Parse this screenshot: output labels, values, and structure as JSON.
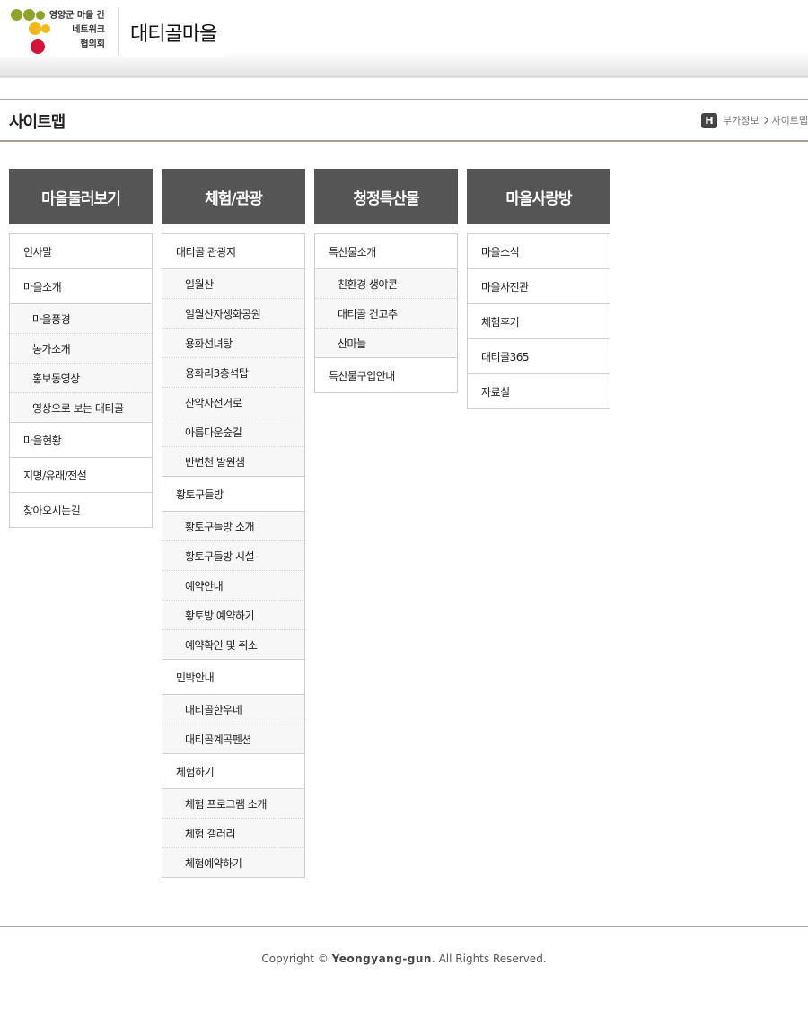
{
  "header": {
    "logo_line1": "영양군 마을 간",
    "logo_line2": "네트워크",
    "logo_line3": "협의회",
    "village_name": "대티골마을",
    "colors": {
      "olive": "#8fa22a",
      "yellow": "#f3b81b",
      "red": "#d2143a"
    }
  },
  "titlebar": {
    "title": "사이트맵",
    "home_icon_label": "H",
    "crumb1": "부가정보",
    "crumb2": "사이트맵"
  },
  "columns": [
    {
      "title": "마을둘러보기",
      "items": [
        "인사말",
        "마을소개",
        "마을현황",
        "지명/유래/전설",
        "찾아오시는길"
      ],
      "subs_of_item1": [
        "마을풍경",
        "농가소개",
        "홍보동영상",
        "영상으로 보는 대티골"
      ]
    },
    {
      "title": "체험/관광",
      "groups": [
        {
          "label": "대티골 관광지",
          "subs": [
            "일월산",
            "일월산자생화공원",
            "용화선녀탕",
            "용화리3층석탑",
            "산악자전거로",
            "아름다운숲길",
            "반변천 발원샘"
          ]
        },
        {
          "label": "황토구들방",
          "subs": [
            "황토구들방 소개",
            "황토구들방 시설",
            "예약안내",
            "황토방 예약하기",
            "예약확인 및 취소"
          ]
        },
        {
          "label": "민박안내",
          "subs": [
            "대티골한우네",
            "대티골계곡펜션"
          ]
        },
        {
          "label": "체험하기",
          "subs": [
            "체험 프로그램 소개",
            "체험 갤러리",
            "체험예약하기"
          ]
        }
      ]
    },
    {
      "title": "청정특산물",
      "groups": [
        {
          "label": "특산물소개",
          "subs": [
            "친환경 생야콘",
            "대티골 건고추",
            "산마늘"
          ]
        },
        {
          "label": "특산물구입안내",
          "subs": []
        }
      ]
    },
    {
      "title": "마을사랑방",
      "items": [
        "마을소식",
        "마을사진관",
        "체험후기",
        "대티골365",
        "자료실"
      ]
    }
  ],
  "footer": {
    "prefix": "Copyright ©",
    "brand": "Yeongyang-gun",
    "suffix": ". All Rights Reserved."
  }
}
